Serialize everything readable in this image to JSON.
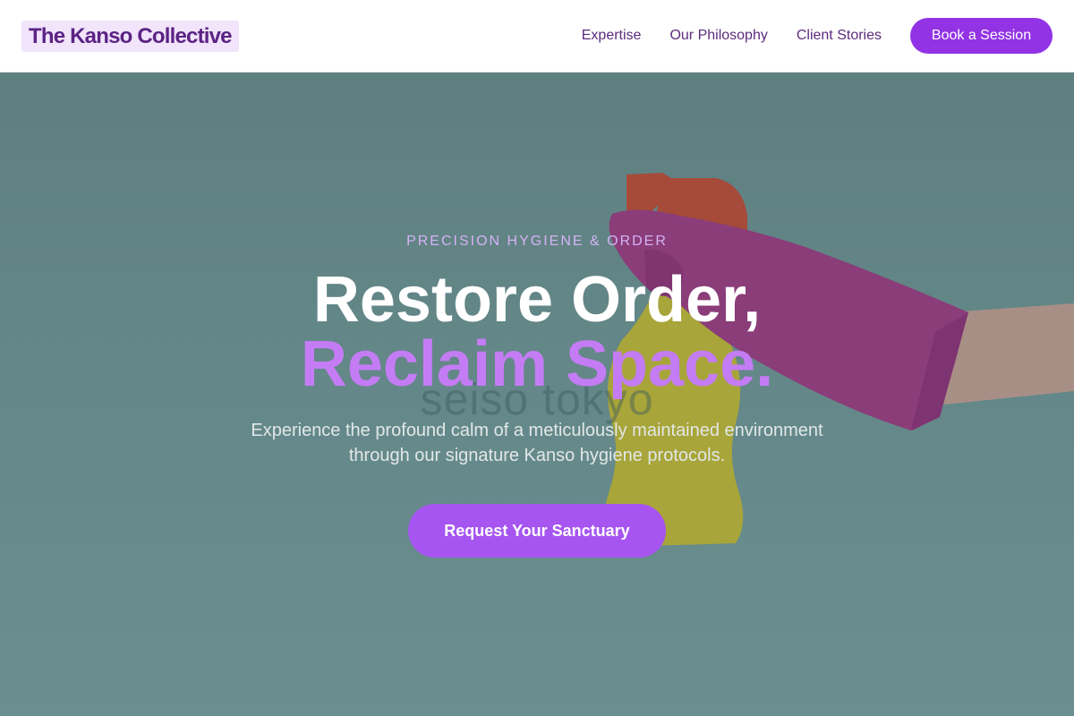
{
  "header": {
    "logo": "The Kanso Collective",
    "nav": [
      {
        "label": "Expertise"
      },
      {
        "label": "Our Philosophy"
      },
      {
        "label": "Client Stories"
      }
    ],
    "cta_label": "Book a Session"
  },
  "hero": {
    "eyebrow": "PRECISION HYGIENE & ORDER",
    "headline_line1": "Restore Order,",
    "headline_line2": "Reclaim Space.",
    "subtitle": "Experience the profound calm of a meticulously maintained environment through our signature Kanso hygiene protocols.",
    "cta_label": "Request Your Sanctuary",
    "background_watermark": "seiso tokyo"
  },
  "colors": {
    "accent": "#9233e6",
    "headline_accent": "#c47cf5",
    "hero_overlay": "#5e7f80",
    "logo_bg": "#f1e4fb"
  }
}
